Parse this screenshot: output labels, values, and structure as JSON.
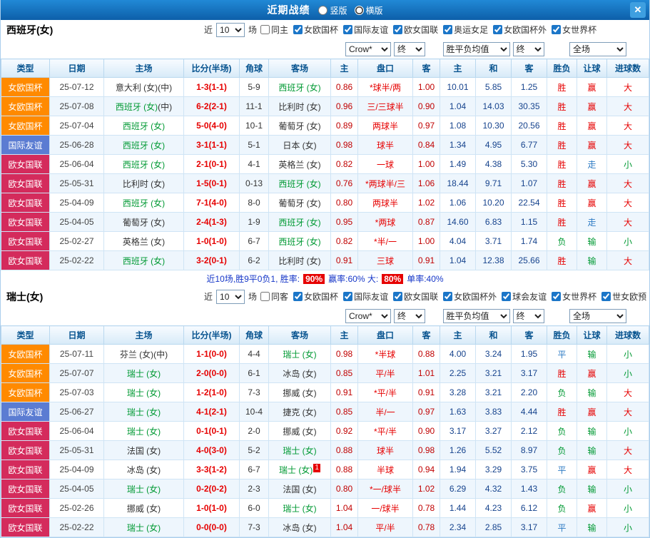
{
  "titlebar": {
    "title": "近期战绩",
    "layout_options": [
      {
        "label": "竖版",
        "selected": false
      },
      {
        "label": "横版",
        "selected": true
      }
    ],
    "close_label": "✕"
  },
  "labels": {
    "recent_prefix": "近",
    "recent_suffix": "场"
  },
  "controls": {
    "company": "Crow*",
    "company_time": "终",
    "avg": "胜平负均值",
    "avg_time": "终",
    "scope": "全场"
  },
  "columns": [
    "类型",
    "日期",
    "主场",
    "比分(半场)",
    "角球",
    "客场",
    "主",
    "盘口",
    "客",
    "主",
    "和",
    "客",
    "胜负",
    "让球",
    "进球数"
  ],
  "palette": {
    "type_colors": {
      "女欧国杯": "#ff8a00",
      "国际友谊": "#5b7cd2",
      "欧女国联": "#d42b5c"
    },
    "result_colors": {
      "胜": "#e60000",
      "赢": "#e60000",
      "大": "#e60000",
      "负": "#009933",
      "输": "#009933",
      "小": "#009933",
      "平": "#2e7bc4",
      "走": "#2e7bc4"
    },
    "focus_team": "#009933",
    "score": "#e60000",
    "handicap_text": "#e60000",
    "handicap_odds": "#c00000",
    "europe_odds": "#16438d",
    "rate_badge_bg": "#e60000"
  },
  "spain": {
    "title": "西班牙(女)",
    "recent_count": "10",
    "filters": [
      {
        "label": "同主",
        "checked": false
      },
      {
        "label": "女欧国杯",
        "checked": true
      },
      {
        "label": "国际友谊",
        "checked": true
      },
      {
        "label": "欧女国联",
        "checked": true
      },
      {
        "label": "奥运女足",
        "checked": true
      },
      {
        "label": "女欧国杯外",
        "checked": true
      },
      {
        "label": "女世界杯",
        "checked": true
      }
    ],
    "rows": [
      {
        "type": "女欧国杯",
        "date": "25-07-12",
        "home": "意大利 (女)",
        "home_mark": "(中)",
        "home_focus": false,
        "score": "1-3(1-1)",
        "corner": "5-9",
        "away": "西班牙 (女)",
        "away_focus": true,
        "h1": "0.86",
        "handicap": "*球半/两",
        "h2": "1.00",
        "o1": "10.01",
        "o2": "5.85",
        "o3": "1.25",
        "r1": "胜",
        "r2": "赢",
        "r3": "大"
      },
      {
        "type": "女欧国杯",
        "date": "25-07-08",
        "home": "西班牙 (女)",
        "home_mark": "(中)",
        "home_focus": true,
        "score": "6-2(2-1)",
        "corner": "11-1",
        "away": "比利时 (女)",
        "away_focus": false,
        "h1": "0.96",
        "handicap": "三/三球半",
        "h2": "0.90",
        "o1": "1.04",
        "o2": "14.03",
        "o3": "30.35",
        "r1": "胜",
        "r2": "赢",
        "r3": "大"
      },
      {
        "type": "女欧国杯",
        "date": "25-07-04",
        "home": "西班牙 (女)",
        "home_focus": true,
        "score": "5-0(4-0)",
        "corner": "10-1",
        "away": "葡萄牙 (女)",
        "away_focus": false,
        "h1": "0.89",
        "handicap": "两球半",
        "h2": "0.97",
        "o1": "1.08",
        "o2": "10.30",
        "o3": "20.56",
        "r1": "胜",
        "r2": "赢",
        "r3": "大"
      },
      {
        "type": "国际友谊",
        "date": "25-06-28",
        "home": "西班牙 (女)",
        "home_focus": true,
        "score": "3-1(1-1)",
        "corner": "5-1",
        "away": "日本 (女)",
        "away_focus": false,
        "h1": "0.98",
        "handicap": "球半",
        "h2": "0.84",
        "o1": "1.34",
        "o2": "4.95",
        "o3": "6.77",
        "r1": "胜",
        "r2": "赢",
        "r3": "大"
      },
      {
        "type": "欧女国联",
        "date": "25-06-04",
        "home": "西班牙 (女)",
        "home_focus": true,
        "score": "2-1(0-1)",
        "corner": "4-1",
        "away": "英格兰 (女)",
        "away_focus": false,
        "h1": "0.82",
        "handicap": "一球",
        "h2": "1.00",
        "o1": "1.49",
        "o2": "4.38",
        "o3": "5.30",
        "r1": "胜",
        "r2": "走",
        "r3": "小"
      },
      {
        "type": "欧女国联",
        "date": "25-05-31",
        "home": "比利时 (女)",
        "home_focus": false,
        "score": "1-5(0-1)",
        "corner": "0-13",
        "away": "西班牙 (女)",
        "away_focus": true,
        "h1": "0.76",
        "handicap": "*两球半/三",
        "h2": "1.06",
        "o1": "18.44",
        "o2": "9.71",
        "o3": "1.07",
        "r1": "胜",
        "r2": "赢",
        "r3": "大"
      },
      {
        "type": "欧女国联",
        "date": "25-04-09",
        "home": "西班牙 (女)",
        "home_focus": true,
        "score": "7-1(4-0)",
        "corner": "8-0",
        "away": "葡萄牙 (女)",
        "away_focus": false,
        "h1": "0.80",
        "handicap": "两球半",
        "h2": "1.02",
        "o1": "1.06",
        "o2": "10.20",
        "o3": "22.54",
        "r1": "胜",
        "r2": "赢",
        "r3": "大"
      },
      {
        "type": "欧女国联",
        "date": "25-04-05",
        "home": "葡萄牙 (女)",
        "home_focus": false,
        "score": "2-4(1-3)",
        "corner": "1-9",
        "away": "西班牙 (女)",
        "away_focus": true,
        "h1": "0.95",
        "handicap": "*两球",
        "h2": "0.87",
        "o1": "14.60",
        "o2": "6.83",
        "o3": "1.15",
        "r1": "胜",
        "r2": "走",
        "r3": "大"
      },
      {
        "type": "欧女国联",
        "date": "25-02-27",
        "home": "英格兰 (女)",
        "home_focus": false,
        "score": "1-0(1-0)",
        "corner": "6-7",
        "away": "西班牙 (女)",
        "away_focus": true,
        "h1": "0.82",
        "handicap": "*半/一",
        "h2": "1.00",
        "o1": "4.04",
        "o2": "3.71",
        "o3": "1.74",
        "r1": "负",
        "r2": "输",
        "r3": "小"
      },
      {
        "type": "欧女国联",
        "date": "25-02-22",
        "home": "西班牙 (女)",
        "home_focus": true,
        "score": "3-2(0-1)",
        "corner": "6-2",
        "away": "比利时 (女)",
        "away_focus": false,
        "h1": "0.91",
        "handicap": "三球",
        "h2": "0.91",
        "o1": "1.04",
        "o2": "12.38",
        "o3": "25.66",
        "r1": "胜",
        "r2": "输",
        "r3": "大"
      }
    ],
    "summary": {
      "prefix": "近10场,胜9平0负1, 胜率:",
      "win_rate": "90%",
      "mid": "赢率:60% 大:",
      "big_rate": "80%",
      "suffix": "单率:40%"
    }
  },
  "swiss": {
    "title": "瑞士(女)",
    "recent_count": "10",
    "filters": [
      {
        "label": "同客",
        "checked": false
      },
      {
        "label": "女欧国杯",
        "checked": true
      },
      {
        "label": "国际友谊",
        "checked": true
      },
      {
        "label": "欧女国联",
        "checked": true
      },
      {
        "label": "女欧国杯外",
        "checked": true
      },
      {
        "label": "球会友谊",
        "checked": true
      },
      {
        "label": "女世界杯",
        "checked": true
      },
      {
        "label": "世女欧预",
        "checked": true
      }
    ],
    "rows": [
      {
        "type": "女欧国杯",
        "date": "25-07-11",
        "home": "芬兰 (女)",
        "home_mark": "(中)",
        "home_focus": false,
        "score": "1-1(0-0)",
        "corner": "4-4",
        "away": "瑞士 (女)",
        "away_focus": true,
        "h1": "0.98",
        "handicap": "*半球",
        "h2": "0.88",
        "o1": "4.00",
        "o2": "3.24",
        "o3": "1.95",
        "r1": "平",
        "r2": "输",
        "r3": "小"
      },
      {
        "type": "女欧国杯",
        "date": "25-07-07",
        "home": "瑞士 (女)",
        "home_focus": true,
        "score": "2-0(0-0)",
        "corner": "6-1",
        "away": "冰岛 (女)",
        "away_focus": false,
        "h1": "0.85",
        "handicap": "平/半",
        "h2": "1.01",
        "o1": "2.25",
        "o2": "3.21",
        "o3": "3.17",
        "r1": "胜",
        "r2": "赢",
        "r3": "小"
      },
      {
        "type": "女欧国杯",
        "date": "25-07-03",
        "home": "瑞士 (女)",
        "home_focus": true,
        "score": "1-2(1-0)",
        "corner": "7-3",
        "away": "挪威 (女)",
        "away_focus": false,
        "h1": "0.91",
        "handicap": "*平/半",
        "h2": "0.91",
        "o1": "3.28",
        "o2": "3.21",
        "o3": "2.20",
        "r1": "负",
        "r2": "输",
        "r3": "大"
      },
      {
        "type": "国际友谊",
        "date": "25-06-27",
        "home": "瑞士 (女)",
        "home_focus": true,
        "score": "4-1(2-1)",
        "corner": "10-4",
        "away": "捷克 (女)",
        "away_focus": false,
        "h1": "0.85",
        "handicap": "半/一",
        "h2": "0.97",
        "o1": "1.63",
        "o2": "3.83",
        "o3": "4.44",
        "r1": "胜",
        "r2": "赢",
        "r3": "大"
      },
      {
        "type": "欧女国联",
        "date": "25-06-04",
        "home": "瑞士 (女)",
        "home_focus": true,
        "score": "0-1(0-1)",
        "corner": "2-0",
        "away": "挪威 (女)",
        "away_focus": false,
        "h1": "0.92",
        "handicap": "*平/半",
        "h2": "0.90",
        "o1": "3.17",
        "o2": "3.27",
        "o3": "2.12",
        "r1": "负",
        "r2": "输",
        "r3": "小"
      },
      {
        "type": "欧女国联",
        "date": "25-05-31",
        "home": "法国 (女)",
        "home_focus": false,
        "score": "4-0(3-0)",
        "corner": "5-2",
        "away": "瑞士 (女)",
        "away_focus": true,
        "h1": "0.88",
        "handicap": "球半",
        "h2": "0.98",
        "o1": "1.26",
        "o2": "5.52",
        "o3": "8.97",
        "r1": "负",
        "r2": "输",
        "r3": "大"
      },
      {
        "type": "欧女国联",
        "date": "25-04-09",
        "home": "冰岛 (女)",
        "home_focus": false,
        "score": "3-3(1-2)",
        "corner": "6-7",
        "away": "瑞士 (女)",
        "away_focus": true,
        "away_badge": "1",
        "h1": "0.88",
        "handicap": "半球",
        "h2": "0.94",
        "o1": "1.94",
        "o2": "3.29",
        "o3": "3.75",
        "r1": "平",
        "r2": "赢",
        "r3": "大"
      },
      {
        "type": "欧女国联",
        "date": "25-04-05",
        "home": "瑞士 (女)",
        "home_focus": true,
        "score": "0-2(0-2)",
        "corner": "2-3",
        "away": "法国 (女)",
        "away_focus": false,
        "h1": "0.80",
        "handicap": "*一/球半",
        "h2": "1.02",
        "o1": "6.29",
        "o2": "4.32",
        "o3": "1.43",
        "r1": "负",
        "r2": "输",
        "r3": "小"
      },
      {
        "type": "欧女国联",
        "date": "25-02-26",
        "home": "挪威 (女)",
        "home_focus": false,
        "score": "1-0(1-0)",
        "corner": "6-0",
        "away": "瑞士 (女)",
        "away_focus": true,
        "h1": "1.04",
        "handicap": "一/球半",
        "h2": "0.78",
        "o1": "1.44",
        "o2": "4.23",
        "o3": "6.12",
        "r1": "负",
        "r2": "赢",
        "r3": "小"
      },
      {
        "type": "欧女国联",
        "date": "25-02-22",
        "home": "瑞士 (女)",
        "home_focus": true,
        "score": "0-0(0-0)",
        "corner": "7-3",
        "away": "冰岛 (女)",
        "away_focus": false,
        "h1": "1.04",
        "handicap": "平/半",
        "h2": "0.78",
        "o1": "2.34",
        "o2": "2.85",
        "o3": "3.17",
        "r1": "平",
        "r2": "输",
        "r3": "小"
      }
    ]
  }
}
